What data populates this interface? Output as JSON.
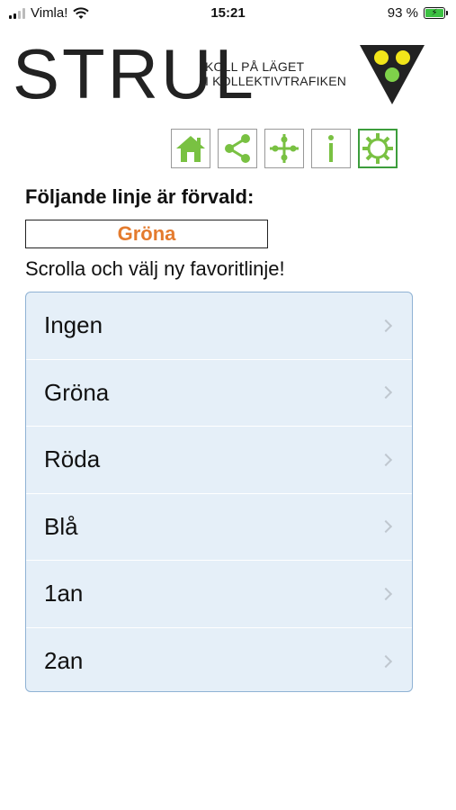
{
  "status_bar": {
    "carrier": "Vimla!",
    "time": "15:21",
    "battery_percent": "93 %",
    "battery_level": 0.93
  },
  "header": {
    "logo_text": "STRUL",
    "tagline_line1": "KOLL PÅ LÄGET",
    "tagline_line2": "I KOLLEKTIVTRAFIKEN"
  },
  "toolbar": {
    "buttons": [
      {
        "icon": "home-icon"
      },
      {
        "icon": "share-icon"
      },
      {
        "icon": "network-icon"
      },
      {
        "icon": "info-icon"
      },
      {
        "icon": "settings-icon",
        "active": true
      }
    ]
  },
  "preset": {
    "heading": "Följande linje är förvald:",
    "current_value": "Gröna",
    "hint": "Scrolla och välj ny favoritlinje!"
  },
  "picker": {
    "items": [
      {
        "label": "Ingen"
      },
      {
        "label": "Gröna"
      },
      {
        "label": "Röda"
      },
      {
        "label": "Blå"
      },
      {
        "label": "1an"
      },
      {
        "label": "2an"
      }
    ]
  },
  "colors": {
    "accent_green": "#79c142",
    "selected_orange": "#e47b2e",
    "picker_background": "#e5eff8",
    "picker_border": "#8fb2d4",
    "battery_fill": "#3cc142"
  }
}
